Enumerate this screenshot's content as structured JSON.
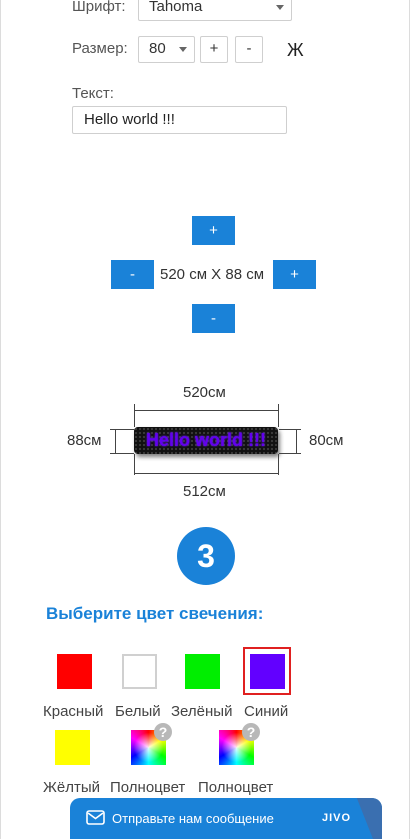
{
  "font_row": {
    "label": "Шрифт:",
    "value": "Tahoma"
  },
  "size_row": {
    "label": "Размер:",
    "value": "80",
    "plus": "+",
    "minus": "-",
    "bold": "Ж"
  },
  "text_row": {
    "label": "Текст:",
    "value": "Hello world !!!"
  },
  "resize": {
    "up": "+",
    "down": "-",
    "left": "-",
    "right": "+",
    "dimensions": "520 см X 88 см"
  },
  "preview": {
    "top_width": "520см",
    "bottom_width": "512см",
    "left_height": "88см",
    "right_height": "80см",
    "sign_text": "Hello world !!!",
    "sign_text_color": "#6200ee"
  },
  "step": {
    "number": "3",
    "heading": "Выберите цвет свечения:"
  },
  "colors": [
    {
      "label": "Красный",
      "hex": "#ff0000"
    },
    {
      "label": "Белый",
      "hex": "#ffffff"
    },
    {
      "label": "Зелёный",
      "hex": "#00ee00"
    },
    {
      "label": "Синий",
      "hex": "#6200ff",
      "selected": true
    },
    {
      "label": "Жёлтый",
      "hex": "#ffff00"
    },
    {
      "label": "Полноцвет",
      "hex": "rainbow"
    },
    {
      "label": "Полноцвет",
      "hex": "rainbow"
    }
  ],
  "help_symbol": "?",
  "chat": {
    "label": "Отправьте нам сообщение",
    "brand": "JIVO",
    "icon": "mail-icon"
  },
  "accent_color": "#1a82d8"
}
